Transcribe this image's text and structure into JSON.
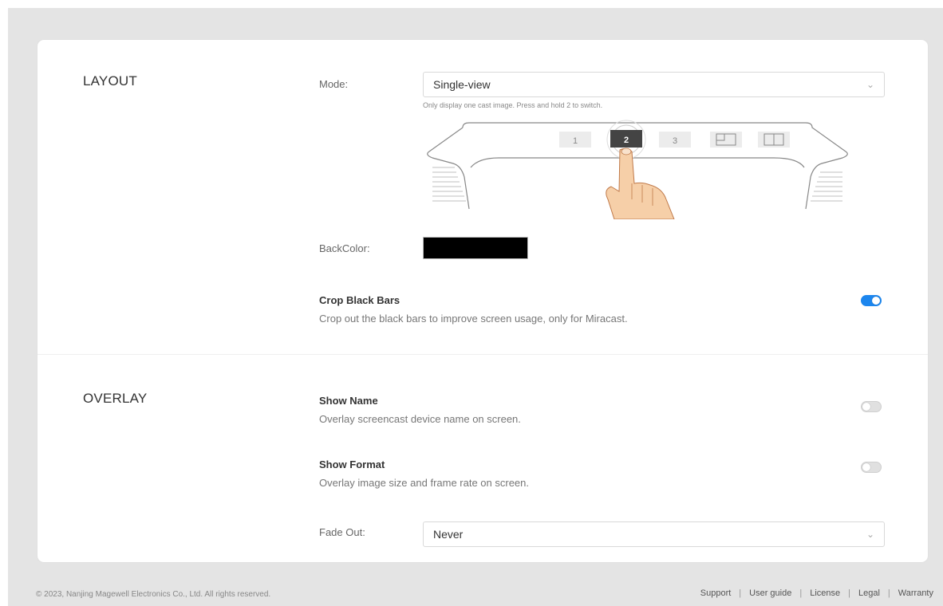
{
  "layout": {
    "title": "LAYOUT",
    "mode": {
      "label": "Mode:",
      "value": "Single-view",
      "hint": "Only display one cast image. Press and hold 2 to switch."
    },
    "illustration": {
      "buttons": [
        "1",
        "2",
        "3"
      ],
      "selected": "2"
    },
    "backcolor": {
      "label": "BackColor:",
      "value": "#000000"
    },
    "crop_black_bars": {
      "title": "Crop Black Bars",
      "description": "Crop out the black bars to improve screen usage, only for Miracast.",
      "enabled": true
    }
  },
  "overlay": {
    "title": "OVERLAY",
    "show_name": {
      "title": "Show Name",
      "description": "Overlay screencast device name on screen.",
      "enabled": false
    },
    "show_format": {
      "title": "Show Format",
      "description": "Overlay image size and frame rate on screen.",
      "enabled": false
    },
    "fade_out": {
      "label": "Fade Out:",
      "value": "Never"
    }
  },
  "footer": {
    "copyright": "© 2023, Nanjing Magewell Electronics Co., Ltd. All rights reserved.",
    "links": [
      "Support",
      "User guide",
      "License",
      "Legal",
      "Warranty"
    ]
  },
  "colors": {
    "accent": "#1c86ee",
    "page_bg": "#e4e4e4",
    "card_bg": "#ffffff"
  }
}
